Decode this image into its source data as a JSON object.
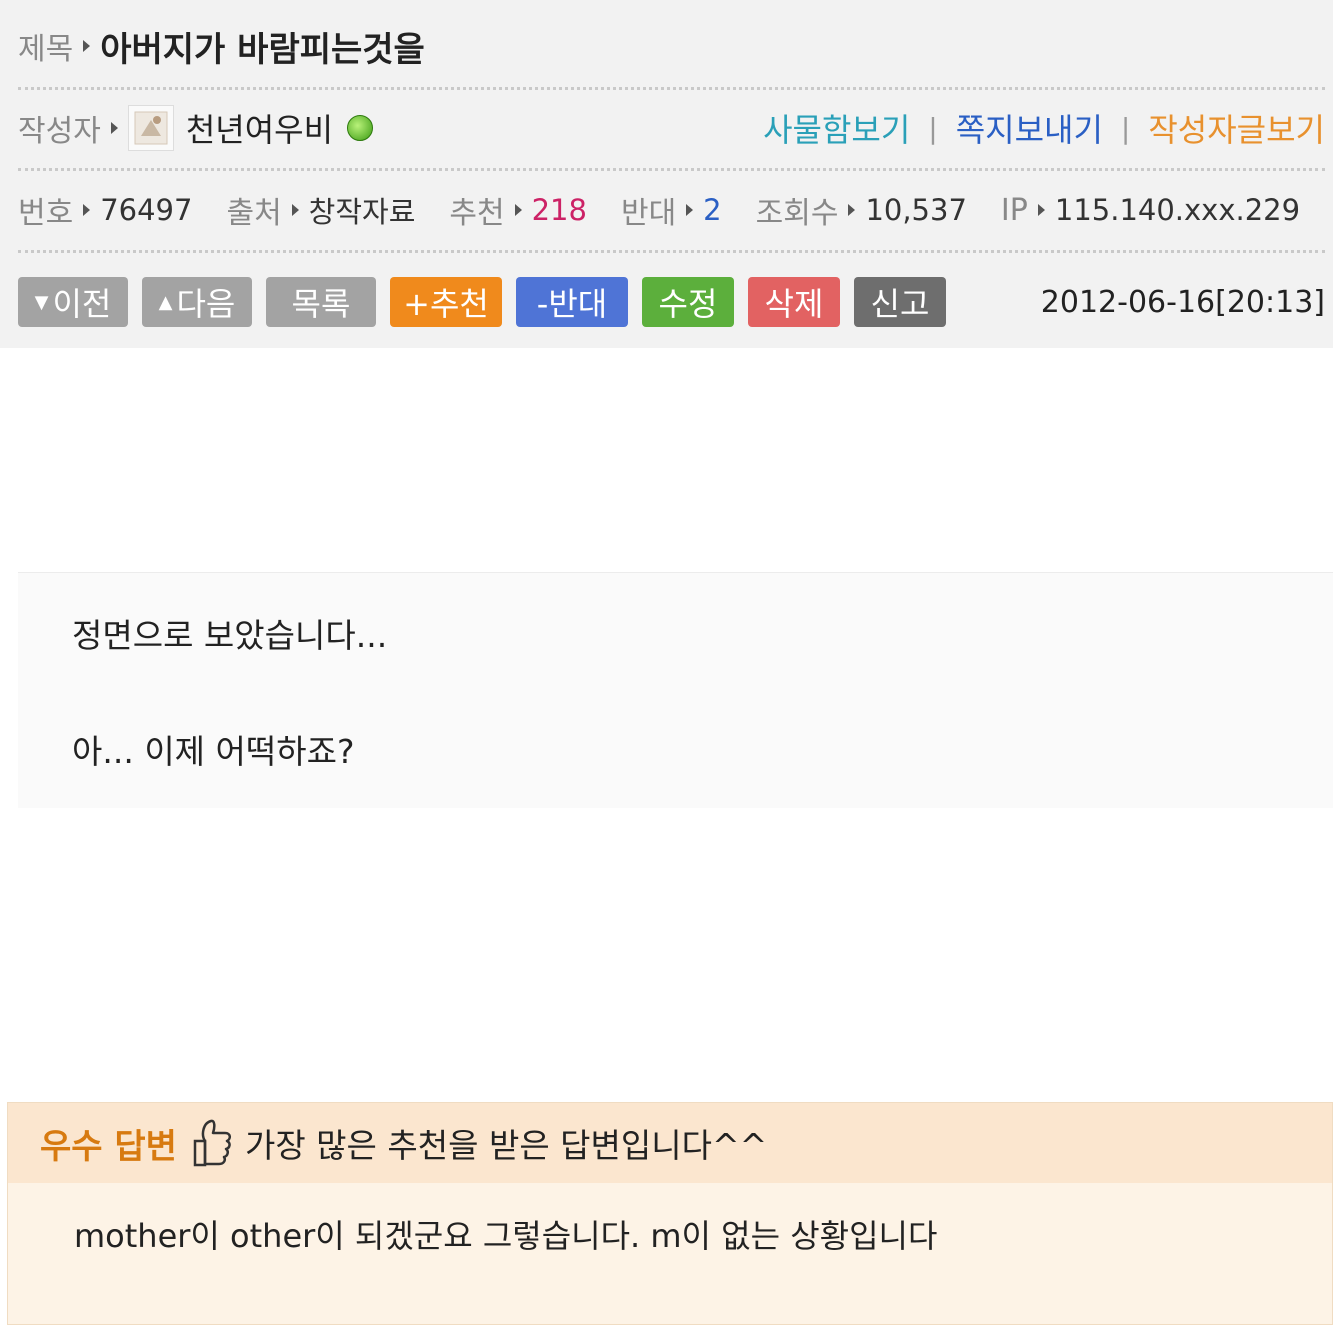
{
  "post": {
    "title_label": "제목",
    "title": "아버지가 바람피는것을",
    "author_label": "작성자",
    "author_name": "천년여우비",
    "links": {
      "inbox": "사물함보기",
      "message": "쪽지보내기",
      "author_posts": "작성자글보기",
      "separator": "|"
    },
    "meta": {
      "number_label": "번호",
      "number": "76497",
      "source_label": "출처",
      "source": "창작자료",
      "recommend_label": "추천",
      "recommend": "218",
      "oppose_label": "반대",
      "oppose": "2",
      "views_label": "조회수",
      "views": "10,537",
      "ip_label": "IP",
      "ip": "115.140.xxx.229"
    },
    "buttons": {
      "prev": "이전",
      "next": "다음",
      "list": "목록",
      "recommend": "+추천",
      "oppose": "-반대",
      "edit": "수정",
      "delete": "삭제",
      "report": "신고"
    },
    "date": "2012-06-16[20:13]",
    "body": [
      "정면으로 보았습니다...",
      "아... 이제 어떡하죠?"
    ]
  },
  "best_answer": {
    "badge": "우수 답변",
    "description": "가장 많은 추천을 받은 답변입니다^^",
    "text": "mother이 other이 되겠군요 그렇습니다. m이 없는 상황입니다"
  },
  "colors": {
    "header_bg": "#f2f2f2",
    "link_teal": "#2aa0b8",
    "link_blue": "#2a5fc4",
    "link_orange": "#e8912e",
    "recommend_count": "#cc2266",
    "oppose_count": "#2a5fc4",
    "btn_gray": "#a3a3a3",
    "btn_orange": "#f08a1c",
    "btn_blue": "#4f74d6",
    "btn_green": "#5caf3c",
    "btn_red": "#e26262",
    "btn_dark": "#6e6e6e",
    "best_badge": "#d77a10"
  },
  "icons": {
    "online": "online-status-icon",
    "avatar": "avatar-image",
    "thumb": "thumbs-up-icon"
  }
}
